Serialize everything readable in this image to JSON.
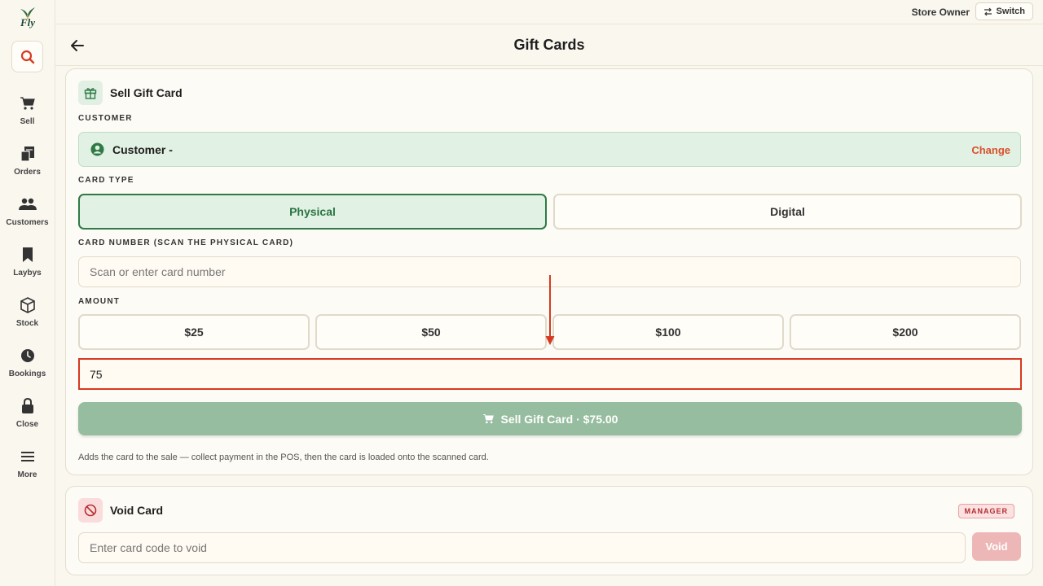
{
  "app": {
    "logo_text": "Fly"
  },
  "sidebar": {
    "items": [
      {
        "label": "Sell",
        "icon": "cart-icon"
      },
      {
        "label": "Orders",
        "icon": "receipt-icon"
      },
      {
        "label": "Customers",
        "icon": "people-icon"
      },
      {
        "label": "Laybys",
        "icon": "bookmark-icon"
      },
      {
        "label": "Stock",
        "icon": "box-icon"
      },
      {
        "label": "Bookings",
        "icon": "clock-icon"
      },
      {
        "label": "Close",
        "icon": "lock-icon"
      },
      {
        "label": "More",
        "icon": "menu-icon"
      }
    ]
  },
  "topbar": {
    "role": "Store Owner",
    "switch_label": "Switch"
  },
  "header": {
    "title": "Gift Cards"
  },
  "sell_card": {
    "title": "Sell Gift Card",
    "customer_label": "CUSTOMER",
    "customer_name": "Customer -",
    "change_label": "Change",
    "card_type_label": "CARD TYPE",
    "card_types": [
      "Physical",
      "Digital"
    ],
    "selected_type": "Physical",
    "card_number_label": "CARD NUMBER (SCAN THE PHYSICAL CARD)",
    "card_number_placeholder": "Scan or enter card number",
    "amount_label": "AMOUNT",
    "amounts": [
      "$25",
      "$50",
      "$100",
      "$200"
    ],
    "custom_amount": "75",
    "sell_button": "Sell Gift Card · $75.00",
    "help_text": "Adds the card to the sale — collect payment in the POS, then the card is loaded onto the scanned card."
  },
  "void_card": {
    "title": "Void Card",
    "badge": "MANAGER",
    "placeholder": "Enter card code to void",
    "button": "Void"
  },
  "colors": {
    "accent_green": "#2f7a47",
    "accent_red": "#d63a22",
    "link_orange": "#d9502b",
    "background": "#faf7ef"
  }
}
